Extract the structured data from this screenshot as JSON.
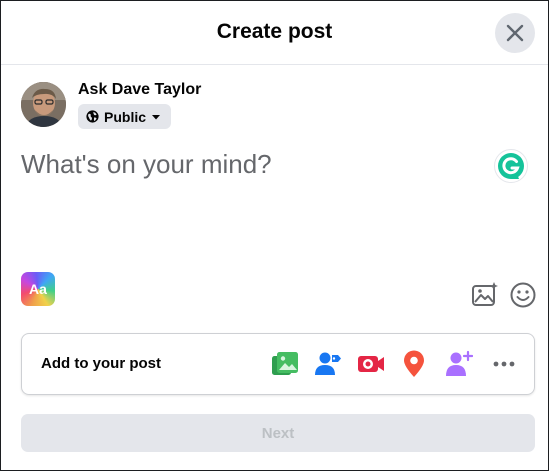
{
  "dialog": {
    "title": "Create post"
  },
  "author": {
    "name": "Ask Dave Taylor",
    "audience": "Public"
  },
  "composer": {
    "placeholder": "What's on your mind?"
  },
  "background_picker": {
    "label": "Aa"
  },
  "add_to_post": {
    "label": "Add to your post",
    "icons": [
      "photo-video-icon",
      "tag-people-icon",
      "live-video-icon",
      "check-in-icon",
      "add-friend-icon",
      "more-icon"
    ]
  },
  "next": {
    "label": "Next"
  },
  "colors": {
    "photo": "#45bd62",
    "tag": "#1877f2",
    "live": "#e42645",
    "checkin": "#f5533d",
    "friend": "#a970ff",
    "disabled_bg": "#e4e6eb",
    "disabled_text": "#bcc0c4"
  }
}
